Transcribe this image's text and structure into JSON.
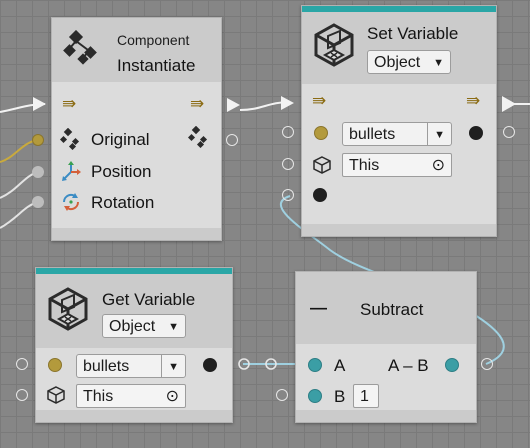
{
  "instantiate_node": {
    "category": "Component",
    "title": "Instantiate",
    "inputs": [
      "Original",
      "Position",
      "Rotation"
    ]
  },
  "set_variable_node": {
    "title": "Set Variable",
    "kind": "Object",
    "variable_name": "bullets",
    "target": "This"
  },
  "get_variable_node": {
    "title": "Get Variable",
    "kind": "Object",
    "variable_name": "bullets",
    "target": "This"
  },
  "subtract_node": {
    "title": "Subtract",
    "input_a": "A",
    "input_b": "B",
    "input_b_value": "1",
    "output": "A – B"
  },
  "glyphs": {
    "flow": "⇛",
    "dropdown_arrow": "▼",
    "target_picker": "⊙",
    "dash": "—"
  },
  "colors": {
    "canvas": "#868686",
    "node_body": "#dcdcdc",
    "header": "#cbcbcb",
    "accent_teal": "#2aa6a6",
    "port_yellow": "#b39a3c",
    "port_teal": "#3b9ea5",
    "flow_arrow": "#8b6b12",
    "wire_white": "#f2f2f2",
    "wire_gold": "#c9aa3d",
    "wire_blue": "#9fd0e0"
  }
}
